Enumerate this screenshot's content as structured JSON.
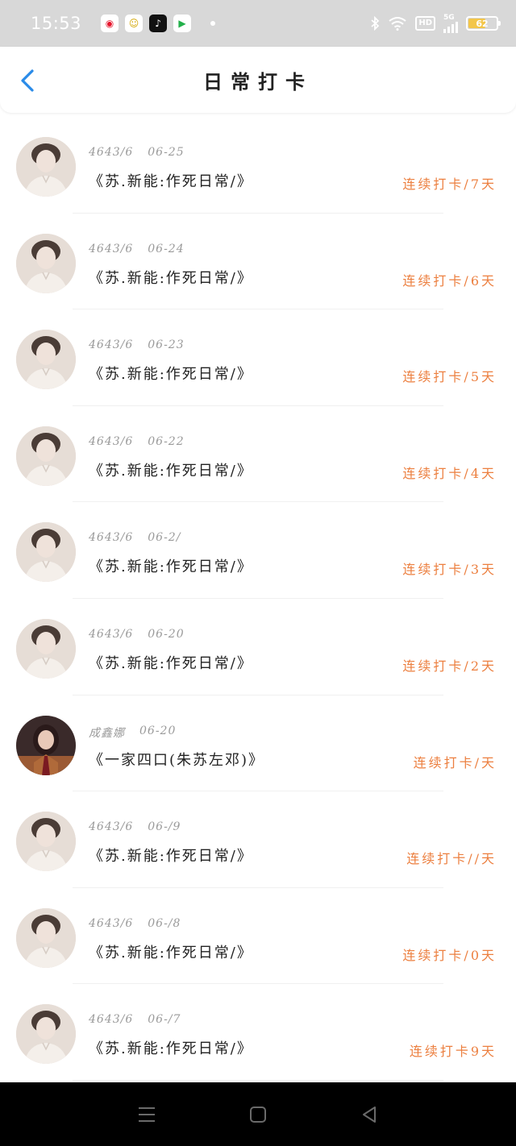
{
  "status_bar": {
    "time": "15:53",
    "network": "5G",
    "hd_label": "HD",
    "battery_level": "62",
    "battery_fraction": 0.62,
    "battery_color": "#f3c64a"
  },
  "header": {
    "title": "日常打卡"
  },
  "colors": {
    "accent_orange": "#ec7f3f",
    "back_blue": "#2a8be8"
  },
  "entries": [
    {
      "user": "4643/6",
      "date": "06-25",
      "title": "《苏.新能:作死日常/》",
      "streak": "连续打卡/7天",
      "avatar": "photo-man"
    },
    {
      "user": "4643/6",
      "date": "06-24",
      "title": "《苏.新能:作死日常/》",
      "streak": "连续打卡/6天",
      "avatar": "photo-man"
    },
    {
      "user": "4643/6",
      "date": "06-23",
      "title": "《苏.新能:作死日常/》",
      "streak": "连续打卡/5天",
      "avatar": "photo-man"
    },
    {
      "user": "4643/6",
      "date": "06-22",
      "title": "《苏.新能:作死日常/》",
      "streak": "连续打卡/4天",
      "avatar": "photo-man"
    },
    {
      "user": "4643/6",
      "date": "06-2/",
      "title": "《苏.新能:作死日常/》",
      "streak": "连续打卡/3天",
      "avatar": "photo-man"
    },
    {
      "user": "4643/6",
      "date": "06-20",
      "title": "《苏.新能:作死日常/》",
      "streak": "连续打卡/2天",
      "avatar": "photo-man"
    },
    {
      "user": "成鑫娜",
      "date": "06-20",
      "title": "《一家四口(朱苏左邓)》",
      "streak": "连续打卡/天",
      "avatar": "photo-woman"
    },
    {
      "user": "4643/6",
      "date": "06-/9",
      "title": "《苏.新能:作死日常/》",
      "streak": "连续打卡//天",
      "avatar": "photo-man"
    },
    {
      "user": "4643/6",
      "date": "06-/8",
      "title": "《苏.新能:作死日常/》",
      "streak": "连续打卡/0天",
      "avatar": "photo-man"
    },
    {
      "user": "4643/6",
      "date": "06-/7",
      "title": "《苏.新能:作死日常/》",
      "streak": "连续打卡9天",
      "avatar": "photo-man"
    }
  ]
}
